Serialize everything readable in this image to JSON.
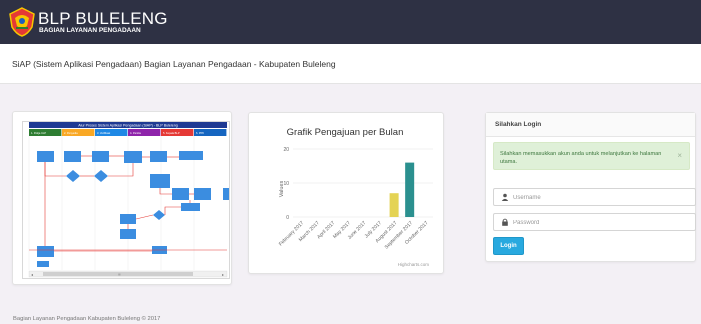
{
  "brand": {
    "title": "BLP BULELENG",
    "subtitle": "BAGIAN LAYANAN PENGADAAN"
  },
  "page_title": "SiAP (Sistem Aplikasi Pengadaan) Bagian Layanan Pengadaan - Kabupaten Buleleng",
  "flowchart": {
    "title": "Alur Proses Sistem Aplikasi Pengadaan (SiAP) - BLP Buleleng",
    "lanes": [
      {
        "color": "#2e7d32"
      },
      {
        "color": "#f9a825"
      },
      {
        "color": "#1e88e5"
      },
      {
        "color": "#8e24aa"
      },
      {
        "color": "#e53935"
      },
      {
        "color": "#1565c0"
      }
    ],
    "lane_labels": [
      "1. Pokja ULP",
      "2. Penyedia",
      "3. Verifikasi",
      "4. Panitia",
      "5. Kepala BLP",
      "6. PPK"
    ],
    "scroll_value": "III"
  },
  "chart_data": {
    "type": "bar",
    "title": "Grafik Pengajuan per Bulan",
    "ylabel": "Values",
    "ylim": [
      0,
      20
    ],
    "yticks": [
      0,
      10,
      20
    ],
    "categories": [
      "February 2017",
      "March 2017",
      "April 2017",
      "May 2017",
      "June 2017",
      "July 2017",
      "August 2017",
      "September 2017",
      "October 2017"
    ],
    "values": [
      0,
      0,
      0,
      0,
      0,
      0,
      7,
      16,
      0
    ],
    "colors": [
      "#7cb5ec",
      "#434348",
      "#90ed7d",
      "#f7a35c",
      "#8085e9",
      "#f15c80",
      "#e4d354",
      "#2b908f",
      "#f45b5b"
    ],
    "credits": "Highcharts.com",
    "grid": true
  },
  "login": {
    "title": "Silahkan Login",
    "alert": "Silahkan memasukkan akun anda untuk melanjutkan ke halaman utama.",
    "close": "×",
    "username_placeholder": "Username",
    "password_placeholder": "Password",
    "button": "Login"
  },
  "footer": "Bagian Layanan Pengadaan Kabupaten Buleleng © 2017",
  "colors": {
    "topbar": "#2e3144",
    "accent": "#28a9df",
    "alert_bg": "#dff0d8"
  }
}
